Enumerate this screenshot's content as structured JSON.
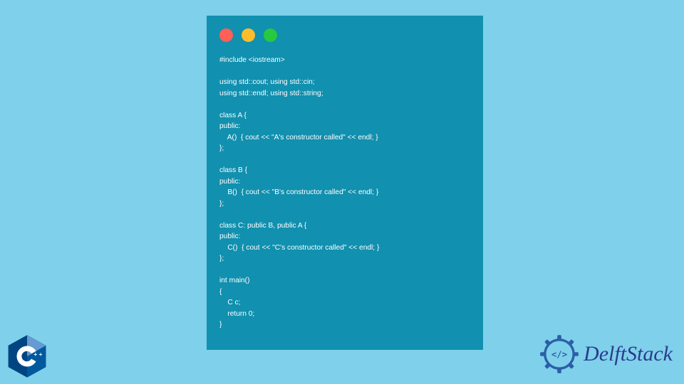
{
  "code": {
    "lines": "#include <iostream>\n\nusing std::cout; using std::cin;\nusing std::endl; using std::string;\n\nclass A {\npublic:\n    A()  { cout << \"A's constructor called\" << endl; }\n};\n\nclass B {\npublic:\n    B()  { cout << \"B's constructor called\" << endl; }\n};\n\nclass C: public B, public A {\npublic:\n    C()  { cout << \"C's constructor called\" << endl; }\n};\n\nint main()\n{\n    C c;\n    return 0;\n}"
  },
  "brand": {
    "name": "DelftStack"
  },
  "cpp_logo": {
    "label": "C++"
  }
}
